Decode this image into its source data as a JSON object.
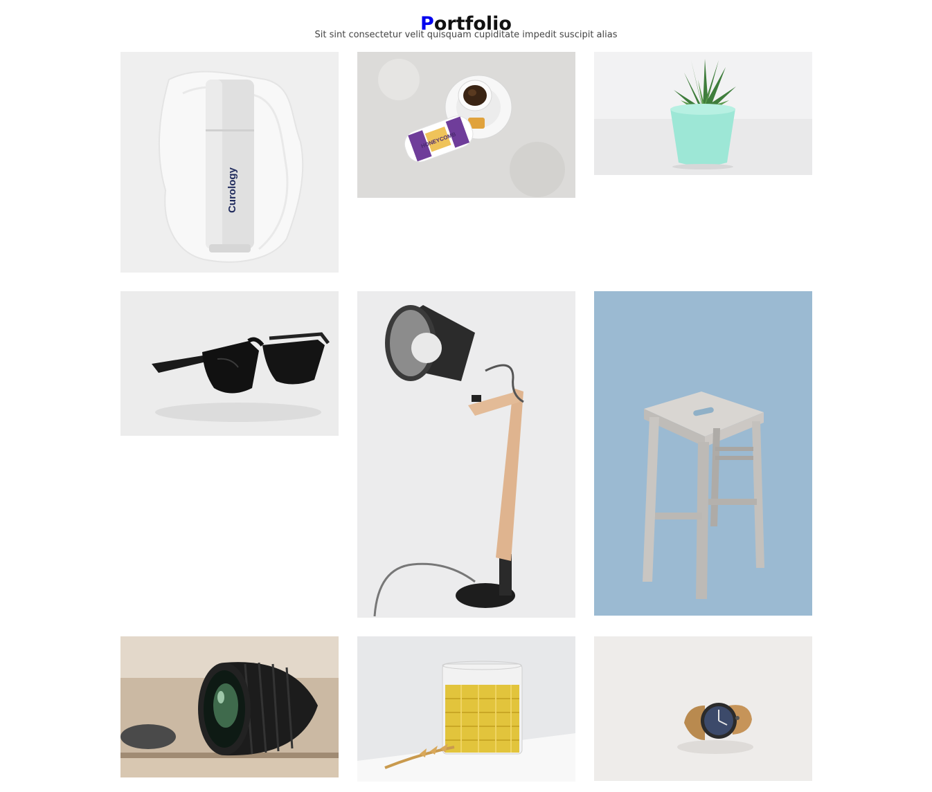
{
  "section": {
    "title_first": "P",
    "title_rest": "ortfolio",
    "subtitle": "Sit sint consectetur velit quisquam cupiditate impedit suscipit alias"
  },
  "portfolio": {
    "items": [
      {
        "subject": "skincare-bottle",
        "label": "Curology"
      },
      {
        "subject": "tea-and-honeycomb",
        "label": "HONEYCOMB"
      },
      {
        "subject": "potted-succulent"
      },
      {
        "subject": "sunglasses"
      },
      {
        "subject": "desk-lamp"
      },
      {
        "subject": "wooden-stool"
      },
      {
        "subject": "camera-lens"
      },
      {
        "subject": "glass-of-tea"
      },
      {
        "subject": "wrist-watch"
      }
    ]
  },
  "colors": {
    "accent": "#0000ee",
    "text": "#111111",
    "muted": "#444444",
    "stool_bg": "#9bbad2"
  }
}
